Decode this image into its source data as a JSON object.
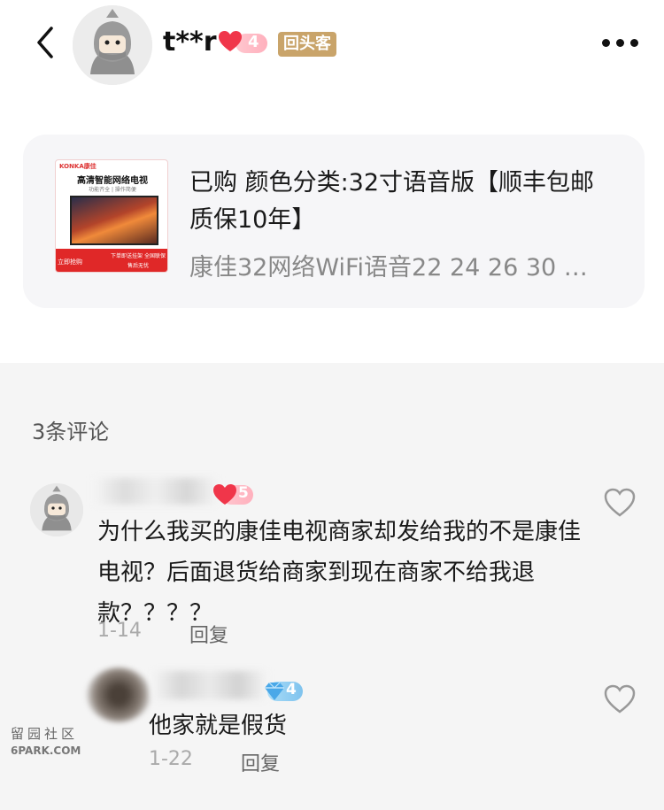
{
  "header": {
    "username": "t**r",
    "level": "4",
    "repeat_customer_tag": "回头客"
  },
  "product": {
    "thumbnail": {
      "brand": "KONKA康佳",
      "title": "高清智能网络电视",
      "subtitle": "功能齐全 | 操作简便",
      "band_left": "立即抢购",
      "band_right": "下单即送挂架 全国联保 售后无忧"
    },
    "purchase_info": "已购 颜色分类:32寸语音版【顺丰包邮 质保10年】",
    "name": "康佳32网络WiFi语音22 24 26 30 …"
  },
  "comments": {
    "count_label": "3条评论",
    "items": [
      {
        "level": "5",
        "text": "为什么我买的康佳电视商家却发给我的不是康佳电视？后面退货给商家到现在商家不给我退款？？？？",
        "date": "1-14",
        "reply_label": "回复"
      },
      {
        "level": "4",
        "text": "他家就是假货",
        "date": "1-22",
        "reply_label": "回复"
      }
    ]
  },
  "watermark": {
    "line1": "留园社区",
    "line2": "6PARK.COM"
  },
  "colors": {
    "heart_red": "#f0364a",
    "repeat_tag_gold": "#c9a46a",
    "diamond_blue": "#4aa8e8"
  }
}
